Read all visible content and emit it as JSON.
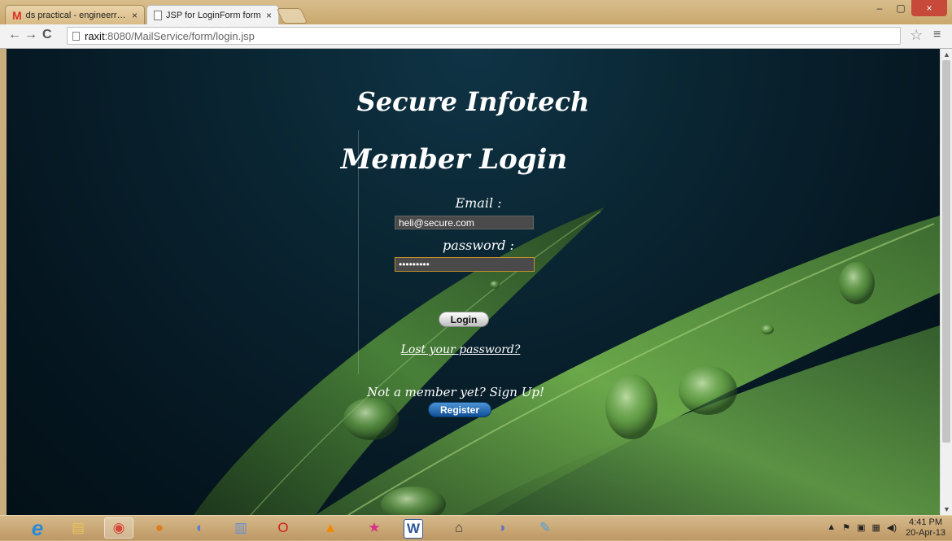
{
  "browser": {
    "tabs": [
      {
        "title": "ds practical - engineerraxit",
        "close": "×"
      },
      {
        "title": "JSP for LoginForm form",
        "close": "×"
      }
    ],
    "window_controls": {
      "minimize": "–",
      "maximize": "▢",
      "close": "×"
    },
    "nav": {
      "back": "←",
      "forward": "→",
      "reload": "C"
    },
    "url_host": "raxit",
    "url_rest": ":8080/MailService/form/login.jsp",
    "star": "☆",
    "menu": "≡"
  },
  "page": {
    "site_title": "Secure Infotech",
    "login_title": "Member Login",
    "email_label": "Email :",
    "email_value": "heli@secure.com",
    "password_label": "password :",
    "password_value": "password1",
    "login_button": "Login",
    "lost_password_link": "Lost your password?",
    "signup_text": "Not a member yet? Sign Up!",
    "register_button": "Register"
  },
  "scrollbar": {
    "up": "▲",
    "down": "▼"
  },
  "taskbar": {
    "apps": [
      {
        "name": "internet-explorer",
        "glyph": "e",
        "color": "#2a8ad6"
      },
      {
        "name": "file-explorer",
        "glyph": "▤",
        "color": "#e8c25a"
      },
      {
        "name": "chrome",
        "glyph": "◉",
        "color": "#d64a3a"
      },
      {
        "name": "firefox",
        "glyph": "●",
        "color": "#e07a1f"
      },
      {
        "name": "app-blue",
        "glyph": "◐",
        "color": "#5a7fd1"
      },
      {
        "name": "database",
        "glyph": "▥",
        "color": "#6a8fcf"
      },
      {
        "name": "opera",
        "glyph": "O",
        "color": "#d0201c"
      },
      {
        "name": "vlc",
        "glyph": "▲",
        "color": "#f08a00"
      },
      {
        "name": "star-app",
        "glyph": "★",
        "color": "#d8308a"
      },
      {
        "name": "word",
        "glyph": "W",
        "color": "#2b5797"
      },
      {
        "name": "tool-app",
        "glyph": "⌂",
        "color": "#3a3a3a"
      },
      {
        "name": "dolphin-app",
        "glyph": "◗",
        "color": "#6a70c8"
      },
      {
        "name": "paint",
        "glyph": "✎",
        "color": "#4aa0d8"
      }
    ],
    "tray_icons": [
      "▲",
      "⚑",
      "▣",
      "▦",
      "◀)"
    ],
    "time": "4:41 PM",
    "date": "20-Apr-13"
  }
}
